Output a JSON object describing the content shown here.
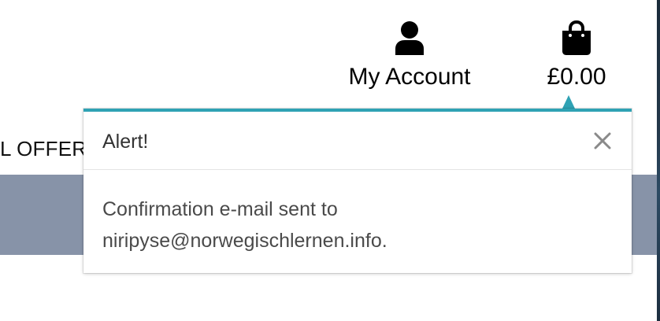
{
  "header": {
    "account": {
      "icon": "user-icon",
      "label": "My Account"
    },
    "bag": {
      "icon": "shopping-bag-icon",
      "label": "£0.00"
    }
  },
  "background": {
    "offer_text": "L OFFER"
  },
  "alert": {
    "title": "Alert!",
    "close_icon": "close-icon",
    "message_line1": "Confirmation e-mail sent to",
    "message_line2": "niripyse@norwegischlernen.info."
  },
  "colors": {
    "accent": "#2fa2b4",
    "band": "#8793a8"
  }
}
